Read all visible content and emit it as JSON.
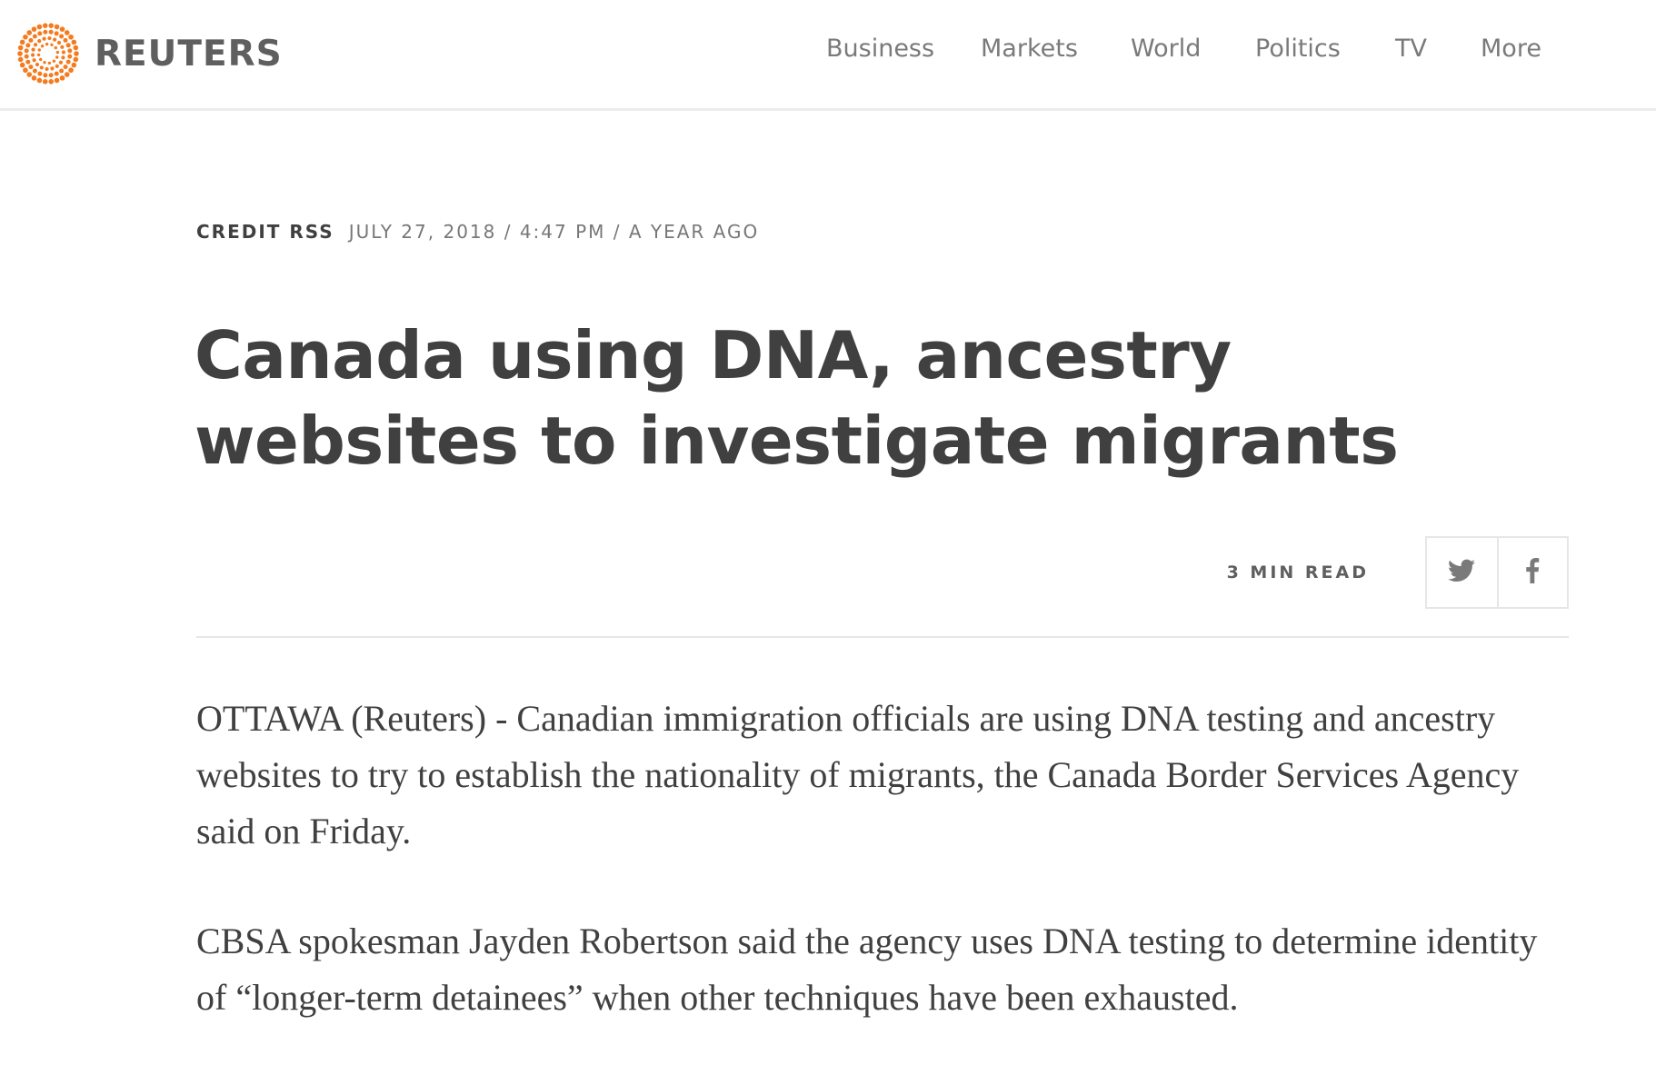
{
  "header": {
    "logo_text": "REUTERS",
    "logo_icon": "reuters-dot-ring-icon",
    "brand_color": "#f47b20",
    "nav": [
      {
        "label": "Business"
      },
      {
        "label": "Markets"
      },
      {
        "label": "World"
      },
      {
        "label": "Politics"
      },
      {
        "label": "TV"
      },
      {
        "label": "More"
      }
    ]
  },
  "article": {
    "source": "CREDIT RSS",
    "date": "JULY 27, 2018 / 4:47 PM / A YEAR AGO",
    "headline": "Canada using DNA, ancestry websites to investigate migrants",
    "read_time": "3 MIN READ",
    "share": {
      "twitter_icon": "twitter-icon",
      "facebook_icon": "facebook-icon"
    },
    "paragraphs": [
      "OTTAWA (Reuters) - Canadian immigration officials are using DNA testing and ancestry websites to try to establish the nationality of migrants, the Canada Border Services Agency said on Friday.",
      "CBSA spokesman Jayden Robertson said the agency uses DNA testing to determine identity of “longer-term detainees” when other techniques have been exhausted."
    ]
  }
}
